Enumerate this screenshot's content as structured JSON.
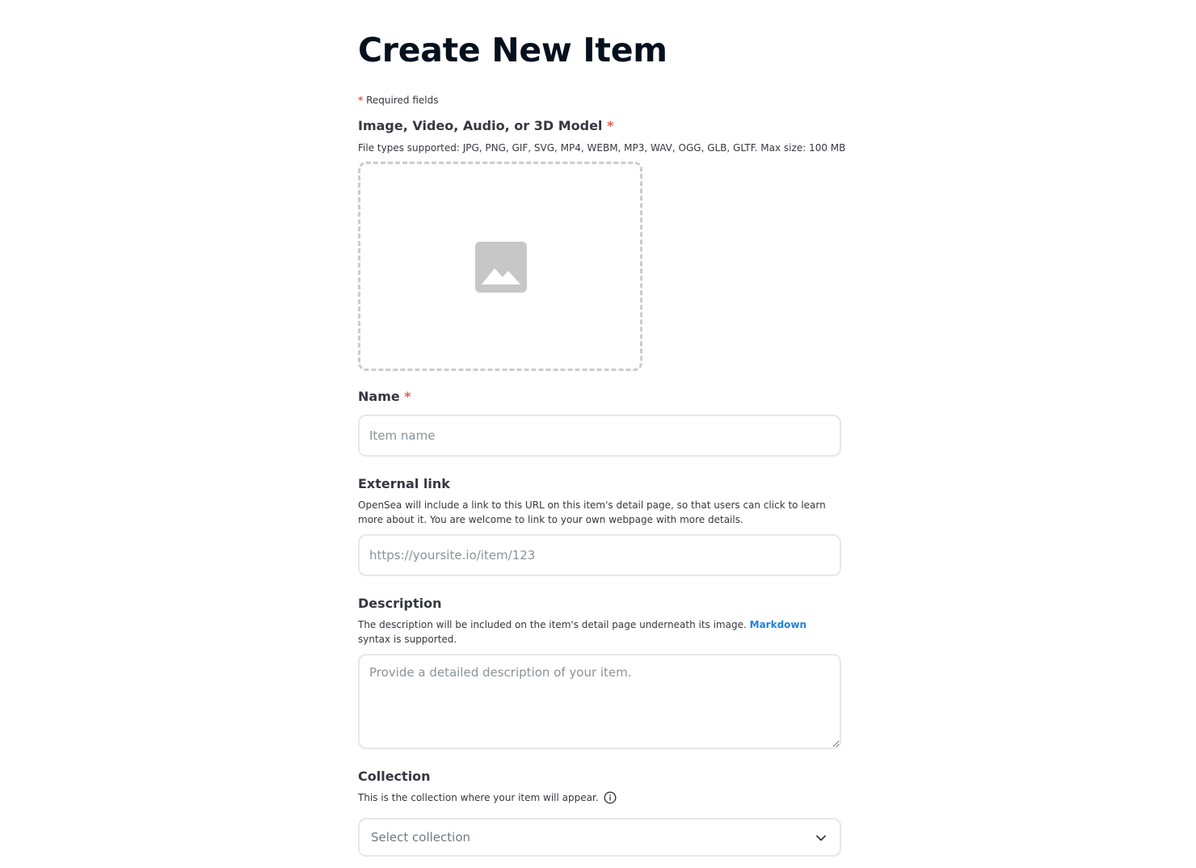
{
  "header": {
    "title": "Create New Item"
  },
  "required_note": {
    "star": "*",
    "text": "Required fields"
  },
  "media": {
    "label": "Image, Video, Audio, or 3D Model",
    "star": "*",
    "help": "File types supported: JPG, PNG, GIF, SVG, MP4, WEBM, MP3, WAV, OGG, GLB, GLTF. Max size: 100 MB",
    "icon": "image-placeholder-icon"
  },
  "name": {
    "label": "Name",
    "star": "*",
    "placeholder": "Item name",
    "value": ""
  },
  "external_link": {
    "label": "External link",
    "help": "OpenSea will include a link to this URL on this item's detail page, so that users can click to learn more about it. You are welcome to link to your own webpage with more details.",
    "placeholder": "https://yoursite.io/item/123",
    "value": ""
  },
  "description": {
    "label": "Description",
    "help_before": "The description will be included on the item's detail page underneath its image.",
    "help_link": "Markdown",
    "help_after": "syntax is supported.",
    "placeholder": "Provide a detailed description of your item.",
    "value": ""
  },
  "collection": {
    "label": "Collection",
    "help": "This is the collection where your item will appear.",
    "info_icon": "info-icon",
    "selected": "Select collection",
    "chevron_icon": "chevron-down-icon"
  },
  "colors": {
    "required_star": "#eb5757",
    "link": "#2081e2",
    "title": "#04111d",
    "input_border": "#e5e8eb",
    "dashed_border": "#cccccc",
    "placeholder": "#8a939b"
  }
}
